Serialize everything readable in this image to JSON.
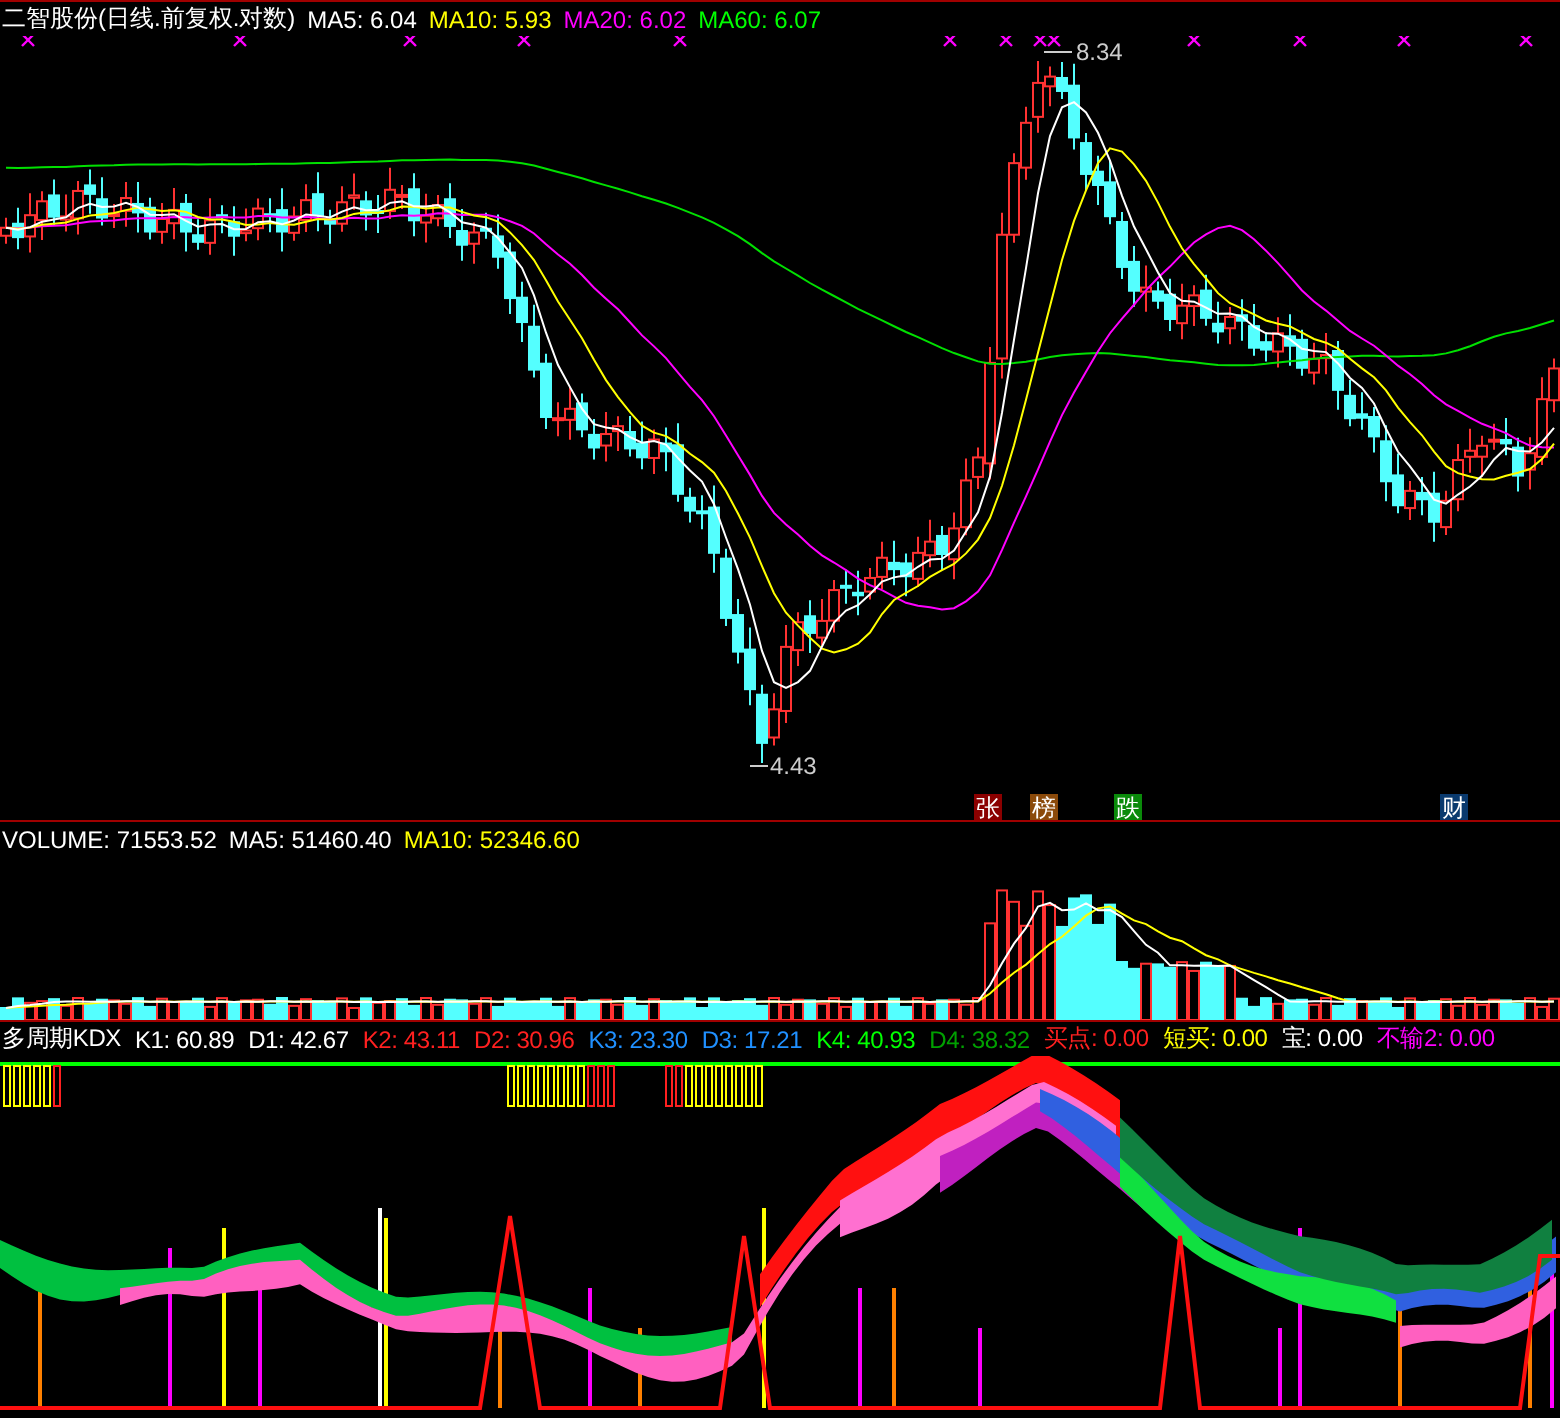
{
  "price_header": {
    "title": "二智股份(日线.前复权.对数)",
    "indicators": [
      {
        "label": "MA5: 6.04",
        "color": "#ffffff"
      },
      {
        "label": "MA10: 5.93",
        "color": "#ffff00"
      },
      {
        "label": "MA20: 6.02",
        "color": "#ff00ff"
      },
      {
        "label": "MA60: 6.07",
        "color": "#00ff00"
      }
    ]
  },
  "price_labels": [
    {
      "text": "8.34"
    },
    {
      "text": "4.43"
    }
  ],
  "event_tags": [
    {
      "text": "张",
      "color": "#8b0000"
    },
    {
      "text": "榜",
      "color": "#8b4a0a"
    },
    {
      "text": "跌",
      "color": "#0a8a0a"
    },
    {
      "text": "财",
      "color": "#0a3a6e"
    }
  ],
  "volume_header": {
    "indicators": [
      {
        "label": "VOLUME: 71553.52",
        "color": "#ffffff"
      },
      {
        "label": "MA5: 51460.40",
        "color": "#ffffff"
      },
      {
        "label": "MA10: 52346.60",
        "color": "#ffff00"
      }
    ]
  },
  "kdx_header": {
    "title": "多周期KDX",
    "indicators": [
      {
        "label": "K1: 60.89",
        "color": "#ffffff"
      },
      {
        "label": "D1: 42.67",
        "color": "#ffffff"
      },
      {
        "label": "K2: 43.11",
        "color": "#ff2020"
      },
      {
        "label": "D2: 30.96",
        "color": "#ff2020"
      },
      {
        "label": "K3: 23.30",
        "color": "#2090ff"
      },
      {
        "label": "D3: 17.21",
        "color": "#2090ff"
      },
      {
        "label": "K4: 40.93",
        "color": "#00ff00"
      },
      {
        "label": "D4: 38.32",
        "color": "#00a000"
      },
      {
        "label": "买点: 0.00",
        "color": "#ff2020"
      },
      {
        "label": "短买: 0.00",
        "color": "#ffff00"
      },
      {
        "label": "宝: 0.00",
        "color": "#ffffff"
      },
      {
        "label": "不输2: 0.00",
        "color": "#ff00ff"
      }
    ]
  }
}
